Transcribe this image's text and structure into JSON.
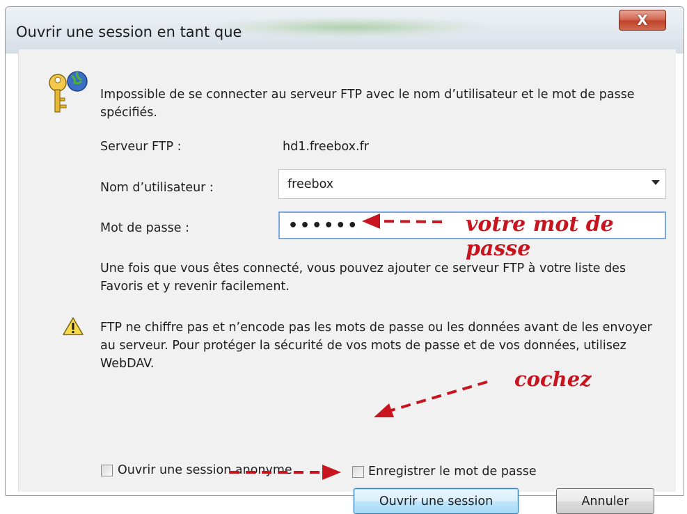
{
  "window": {
    "title": "Ouvrir une session en tant que",
    "close_label": "X"
  },
  "message": "Impossible de se connecter au serveur FTP avec le nom d’utilisateur et le mot de passe spécifiés.",
  "fields": {
    "server_label": "Serveur FTP :",
    "server_value": "hd1.freebox.fr",
    "username_label": "Nom d’utilisateur :",
    "username_value": "freebox",
    "password_label": "Mot de passe :",
    "password_value": "••••••"
  },
  "info_text": "Une fois que vous êtes connecté, vous pouvez ajouter ce serveur FTP à votre liste des Favoris et y revenir facilement.",
  "warning_text": "FTP ne chiffre pas et n’encode pas les mots de passe ou les données avant de les envoyer au serveur. Pour protéger la sécurité de vos mots de passe et de vos données, utilisez WebDAV.",
  "checkboxes": {
    "anonymous_label": "Ouvrir une session anonyme",
    "anonymous_checked": false,
    "save_password_label": "Enregistrer le mot de passe",
    "save_password_checked": false
  },
  "buttons": {
    "login": "Ouvrir une session",
    "cancel": "Annuler"
  },
  "annotations": {
    "password_hint": "votre mot de passe",
    "check_hint": "cochez",
    "color": "#c8141e"
  },
  "icons": {
    "dialog": "keys-globe-icon",
    "warning": "warning-icon"
  }
}
